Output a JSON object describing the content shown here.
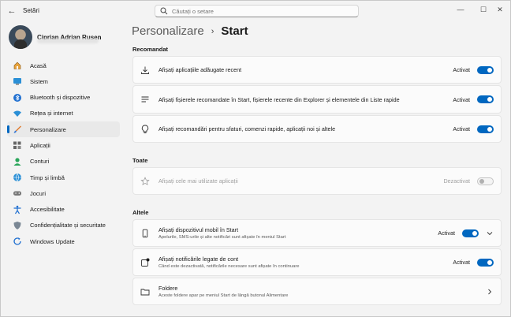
{
  "window": {
    "title": "Setări",
    "back_glyph": "←",
    "minimize_glyph": "—",
    "maximize_glyph": "☐",
    "close_glyph": "✕"
  },
  "search": {
    "placeholder": "Căutați o setare"
  },
  "profile": {
    "name": "Ciprian Adrian Rusen"
  },
  "sidebar": {
    "items": [
      {
        "label": "Acasă",
        "icon": "home-icon",
        "active": false
      },
      {
        "label": "Sistem",
        "icon": "system-icon",
        "active": false
      },
      {
        "label": "Bluetooth și dispozitive",
        "icon": "bluetooth-icon",
        "active": false
      },
      {
        "label": "Rețea și internet",
        "icon": "wifi-icon",
        "active": false
      },
      {
        "label": "Personalizare",
        "icon": "brush-icon",
        "active": true
      },
      {
        "label": "Aplicații",
        "icon": "apps-icon",
        "active": false
      },
      {
        "label": "Conturi",
        "icon": "account-icon",
        "active": false
      },
      {
        "label": "Timp și limbă",
        "icon": "globe-icon",
        "active": false
      },
      {
        "label": "Jocuri",
        "icon": "gamepad-icon",
        "active": false
      },
      {
        "label": "Accesibilitate",
        "icon": "accessibility-icon",
        "active": false
      },
      {
        "label": "Confidențialitate și securitate",
        "icon": "shield-icon",
        "active": false
      },
      {
        "label": "Windows Update",
        "icon": "update-icon",
        "active": false
      }
    ]
  },
  "breadcrumb": {
    "parent": "Personalizare",
    "separator": "›",
    "current": "Start"
  },
  "sections": {
    "recommended": "Recomandat",
    "all": "Toate",
    "other": "Altele"
  },
  "settings": {
    "recent_apps": {
      "title": "Afișați aplicațiile adăugate recent",
      "state": "Activat",
      "on": true,
      "icon": "download-icon"
    },
    "recommended_files": {
      "title": "Afișați fișierele recomandate în Start, fișierele recente din Explorer și elementele din Liste rapide",
      "state": "Activat",
      "on": true,
      "icon": "list-icon"
    },
    "recommendations": {
      "title": "Afișați recomandări pentru sfaturi, comenzi rapide, aplicații noi și altele",
      "state": "Activat",
      "on": true,
      "icon": "lightbulb-icon"
    },
    "most_used": {
      "title": "Afișați cele mai utilizate aplicații",
      "state": "Dezactivat",
      "on": false,
      "icon": "star-icon"
    },
    "mobile_device": {
      "title": "Afișați dispozitivul mobil în Start",
      "subtitle": "Apelurile, SMS-urile și alte notificări sunt afișate în meniul Start",
      "state": "Activat",
      "on": true,
      "icon": "phone-icon"
    },
    "account_notifications": {
      "title": "Afișați notificările legate de cont",
      "subtitle": "Când este dezactivată, notificările necesare sunt afișate în continuare",
      "state": "Activat",
      "on": true,
      "icon": "account-notification-icon"
    },
    "folders": {
      "title": "Foldere",
      "subtitle": "Aceste foldere apar pe meniul Start de lângă butonul Alimentare",
      "icon": "folder-icon"
    }
  },
  "colors": {
    "accent": "#0067c0",
    "background": "#f3f3f3",
    "card": "#fbfbfb"
  }
}
